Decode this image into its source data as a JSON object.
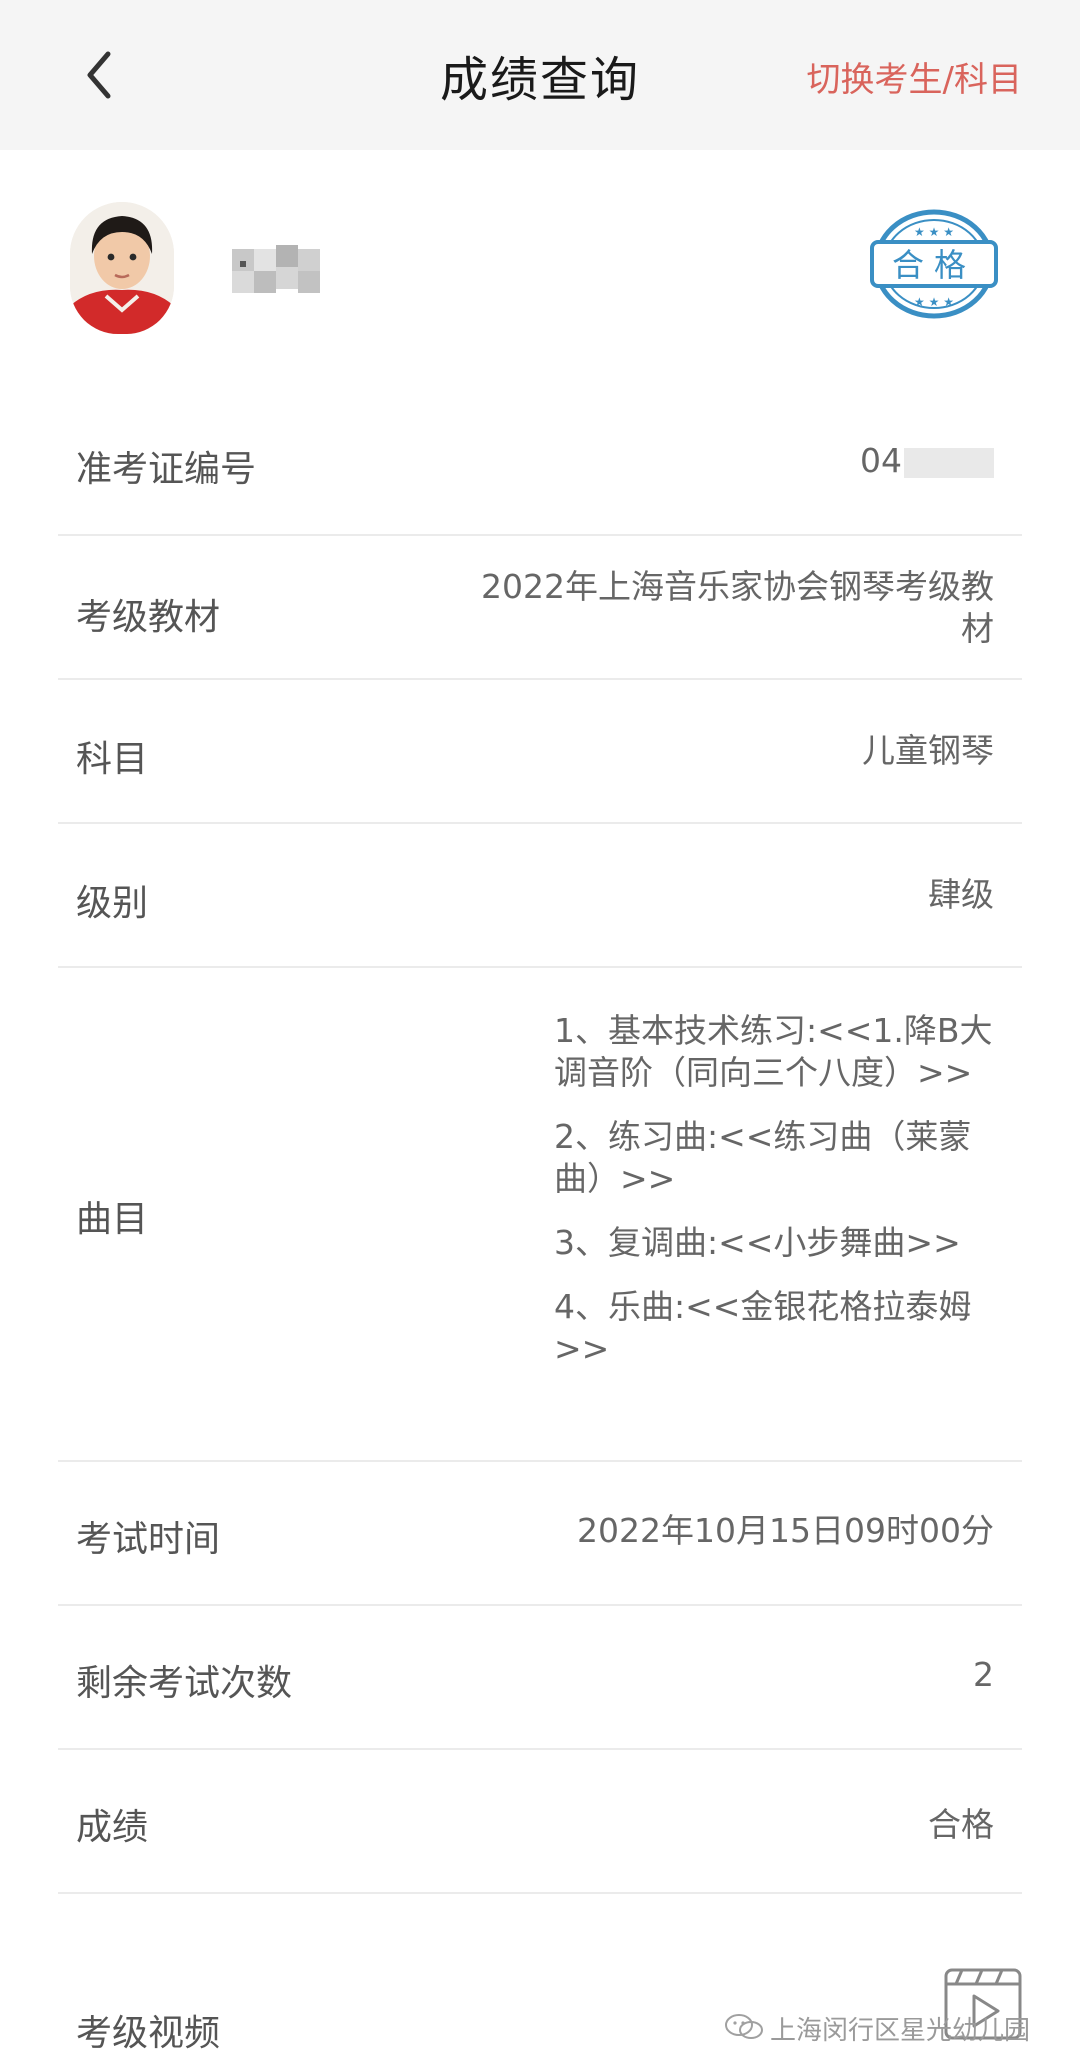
{
  "header": {
    "title": "成绩查询",
    "switch_label": "切换考生/科目"
  },
  "profile": {
    "stamp_text": "合格"
  },
  "fields": {
    "ticket_label": "准考证编号",
    "ticket_value": "04",
    "textbook_label": "考级教材",
    "textbook_value": "2022年上海音乐家协会钢琴考级教材",
    "subject_label": "科目",
    "subject_value": "儿童钢琴",
    "level_label": "级别",
    "level_value": "肆级",
    "repertoire_label": "曲目",
    "repertoire_items": [
      "1、基本技术练习:<<1.降B大调音阶（同向三个八度）>>",
      "2、练习曲:<<练习曲（莱蒙曲）>>",
      "3、复调曲:<<小步舞曲>>",
      "4、乐曲:<<金银花格拉泰姆>>"
    ],
    "exam_time_label": "考试时间",
    "exam_time_value": "2022年10月15日09时00分",
    "remaining_label": "剩余考试次数",
    "remaining_value": "2",
    "score_label": "成绩",
    "score_value": "合格",
    "video_label": "考级视频"
  },
  "watermark": {
    "text": "上海闵行区星光幼儿园"
  },
  "colors": {
    "accent": "#d9645c",
    "stamp": "#3a8fc4"
  },
  "icons": [
    "back-icon",
    "pass-stamp-icon",
    "video-play-icon",
    "wechat-icon"
  ]
}
